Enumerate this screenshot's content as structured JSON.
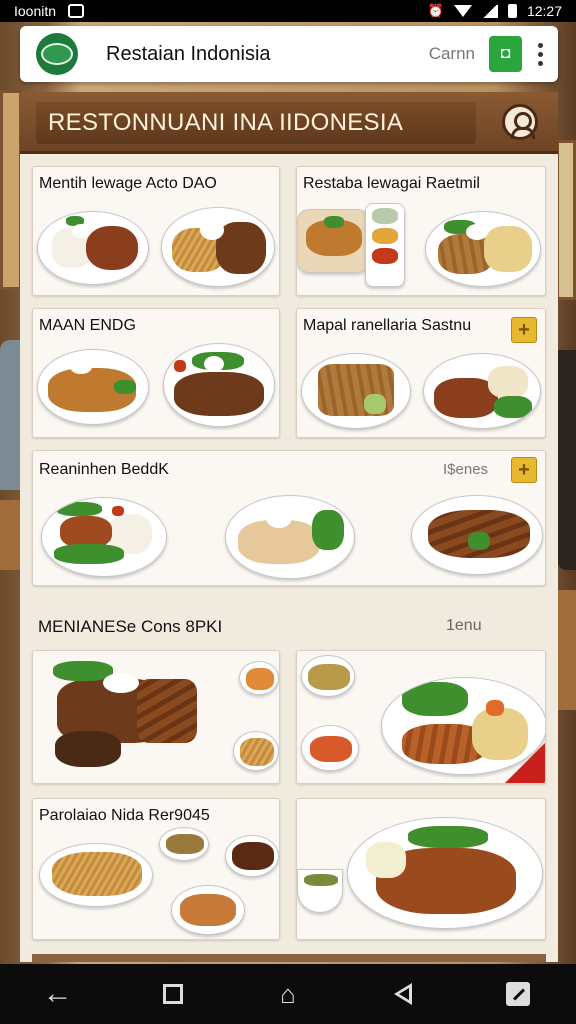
{
  "status_bar": {
    "carrier": "Ioonitn",
    "time": "12:27"
  },
  "app_bar": {
    "title": "Restaian Indonisia",
    "camera_label": "Carnn",
    "camera_icon": "camera-icon",
    "more_icon": "more-vert-icon"
  },
  "banner": {
    "title": "RESTONNUANI INA IIDONESIA",
    "user_icon": "user-icon"
  },
  "cards": [
    {
      "title": "Mentih lewage Acto DAO"
    },
    {
      "title": "Restaba lewagai Raetmil"
    },
    {
      "title": "MAAN ENDG"
    },
    {
      "title": "Mapal ranellaria Sastnu",
      "action": "+"
    },
    {
      "title": "Reaninhen BeddK",
      "aux": "I$enes",
      "action": "+"
    }
  ],
  "section": {
    "title": "MENIANESe Cons 8PKI",
    "aux": "1enu"
  },
  "section_cards": [
    {
      "title": ""
    },
    {
      "title": ""
    },
    {
      "title": "Parolaiao Nida Rer9045"
    },
    {
      "title": ""
    }
  ],
  "colors": {
    "accent_green": "#2aa63c",
    "banner_brown": "#6e4425",
    "action_yellow": "#e8b830"
  }
}
